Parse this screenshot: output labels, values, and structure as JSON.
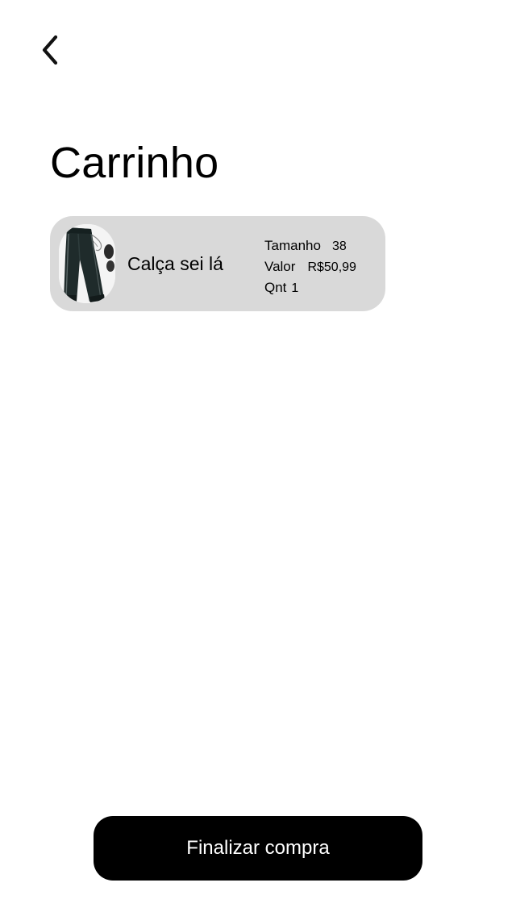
{
  "header": {
    "back_icon": "chevron-left-icon",
    "title": "Carrinho"
  },
  "cart": {
    "items": [
      {
        "image_icon": "pants-product-image",
        "name": "Calça sei lá",
        "size_label": "Tamanho",
        "size_value": "38",
        "price_label": "Valor",
        "price_value": "R$50,99",
        "qty_label": "Qnt",
        "qty_value": "1"
      }
    ]
  },
  "footer": {
    "checkout_label": "Finalizar compra"
  },
  "colors": {
    "card_background": "#d9d9d9",
    "button_background": "#000000",
    "button_text": "#ffffff",
    "text": "#000000"
  }
}
